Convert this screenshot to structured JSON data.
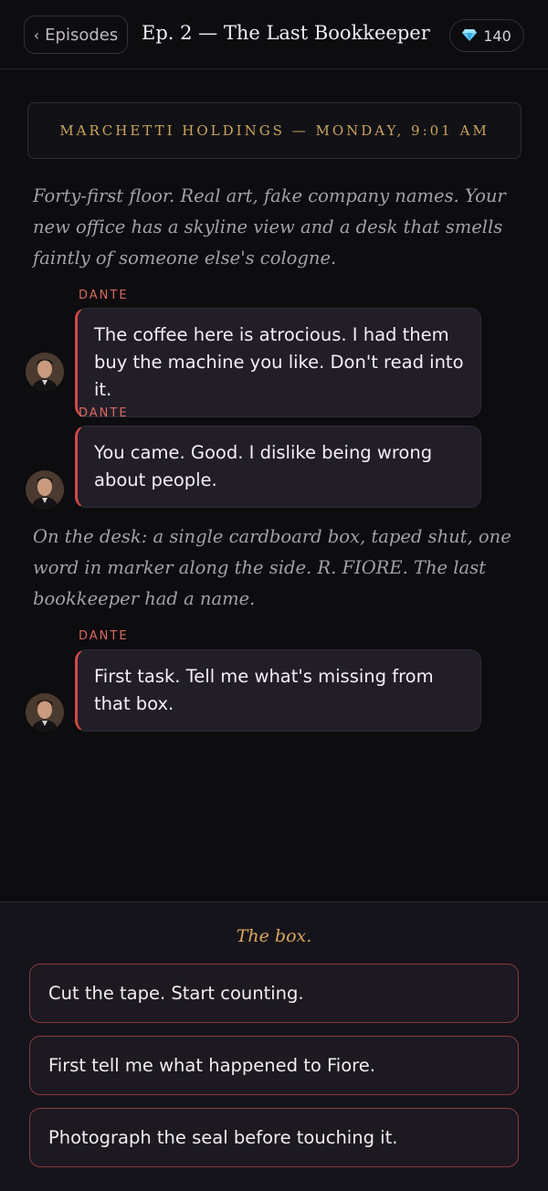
{
  "header": {
    "back_label": "Episodes",
    "back_icon": "chevron-left-icon",
    "episode_title": "Ep. 2 — The Last Bookkeeper",
    "gem_icon": "diamond-icon",
    "gem_count": "140"
  },
  "scene": {
    "location": "MARCHETTI HOLDINGS — MONDAY, 9:01 AM"
  },
  "story": {
    "narration_1": "Forty-first floor. Real art, fake company names. Your new office has a skyline view and a desk that smells faintly of someone else's cologne.",
    "line_1": {
      "speaker": "DANTE",
      "text": "The coffee here is atrocious. I had them buy the machine you like. Don't read into it."
    },
    "line_2": {
      "speaker": "DANTE",
      "text": "You came. Good. I dislike being wrong about people."
    },
    "narration_2": "On the desk: a single cardboard box, taped shut, one word in marker along the side. R. FIORE. The last bookkeeper had a name.",
    "line_3": {
      "speaker": "DANTE",
      "text": "First task. Tell me what's missing from that box."
    }
  },
  "choices": {
    "prompt": "The box.",
    "options": [
      "Cut the tape. Start counting.",
      "First tell me what happened to Fiore.",
      "Photograph the seal before touching it."
    ]
  },
  "colors": {
    "background": "#0d0c0f",
    "accent_gold": "#c9a55b",
    "speaker_red": "#d86a60",
    "bubble_border_red": "#d24a45",
    "choice_border": "#8a3a3e"
  }
}
